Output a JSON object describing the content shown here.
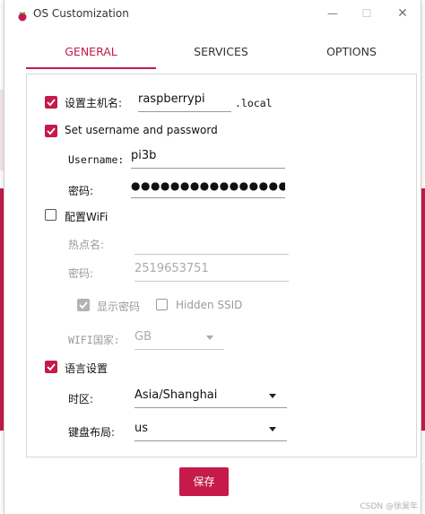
{
  "window": {
    "title": "OS Customization",
    "accent": "#c51a4a"
  },
  "tabs": [
    {
      "label": "GENERAL",
      "active": true
    },
    {
      "label": "SERVICES",
      "active": false
    },
    {
      "label": "OPTIONS",
      "active": false
    }
  ],
  "general": {
    "hostname": {
      "checked": true,
      "label": "设置主机名:",
      "value": "raspberrypi",
      "suffix": ".local"
    },
    "user": {
      "checked": true,
      "label": "Set username and password",
      "username_label": "Username:",
      "username_value": "pi3b",
      "password_label": "密码:",
      "password_value": "●●●●●●●●●●●●●●●●"
    },
    "wifi": {
      "checked": false,
      "label": "配置WiFi",
      "ssid_label": "热点名:",
      "ssid_value": "",
      "password_label": "密码:",
      "password_value": "2519653751",
      "show_password": {
        "checked": true,
        "label": "显示密码"
      },
      "hidden_ssid": {
        "checked": false,
        "label": "Hidden SSID"
      },
      "country_label": "WIFI国家:",
      "country_value": "GB"
    },
    "locale": {
      "checked": true,
      "label": "语言设置",
      "timezone_label": "时区:",
      "timezone_value": "Asia/Shanghai",
      "keyboard_label": "键盘布局:",
      "keyboard_value": "us"
    }
  },
  "footer": {
    "save_label": "保存",
    "watermark": "CSDN @徐昊年"
  }
}
